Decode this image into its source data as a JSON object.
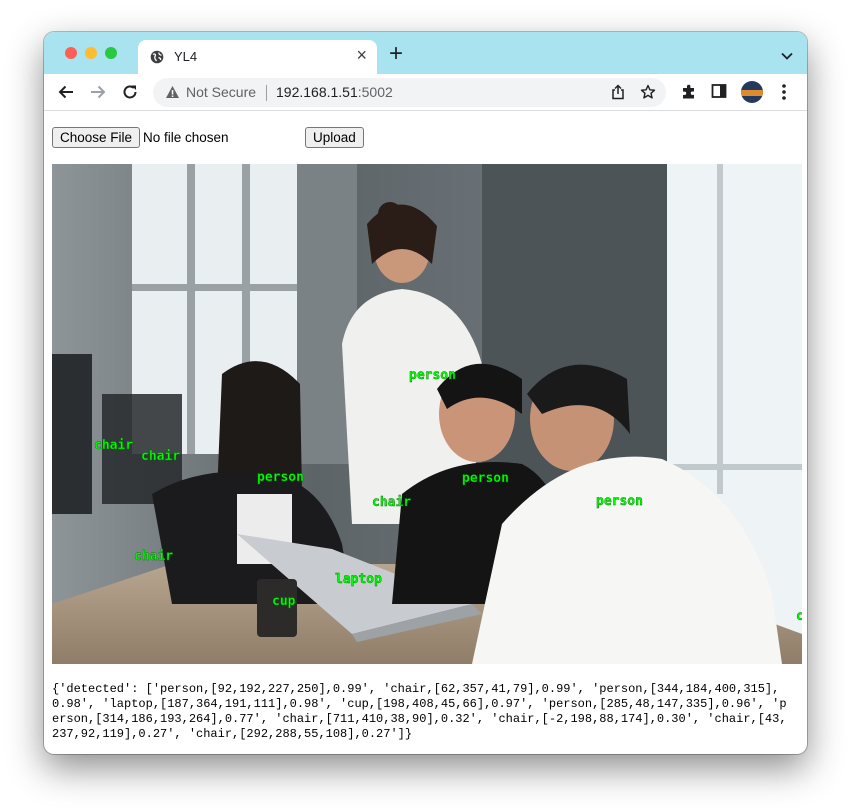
{
  "browser": {
    "tab": {
      "title": "YL4"
    },
    "address": {
      "security_label": "Not Secure",
      "host": "192.168.1.51",
      "port": ":5002"
    }
  },
  "form": {
    "choose_file_label": "Choose File",
    "no_file_text": "No file chosen",
    "upload_label": "Upload"
  },
  "image": {
    "description_icon": "photo-office-people",
    "detections": [
      {
        "label": "person",
        "color": "#00ff00"
      },
      {
        "label": "person",
        "color": "#00ff00"
      },
      {
        "label": "person",
        "color": "#00ff00"
      },
      {
        "label": "person",
        "color": "#00ff00"
      },
      {
        "label": "chair",
        "color": "#00ff00"
      },
      {
        "label": "chair",
        "color": "#00ff00"
      },
      {
        "label": "chair",
        "color": "#00ff00"
      },
      {
        "label": "chair",
        "color": "#00ff00"
      },
      {
        "label": "chair",
        "color": "#00ff00"
      },
      {
        "label": "laptop",
        "color": "#00ff00"
      },
      {
        "label": "cup",
        "color": "#00ff00"
      },
      {
        "label": "ch",
        "color": "#00ff00"
      }
    ]
  },
  "result_text": "{'detected': ['person,[92,192,227,250],0.99', 'chair,[62,357,41,79],0.99', 'person,[344,184,400,315],0.98', 'laptop,[187,364,191,111],0.98', 'cup,[198,408,45,66],0.97', 'person,[285,48,147,335],0.96', 'person,[314,186,193,264],0.77', 'chair,[711,410,38,90],0.32', 'chair,[-2,198,88,174],0.30', 'chair,[43,237,92,119],0.27', 'chair,[292,288,55,108],0.27']}"
}
